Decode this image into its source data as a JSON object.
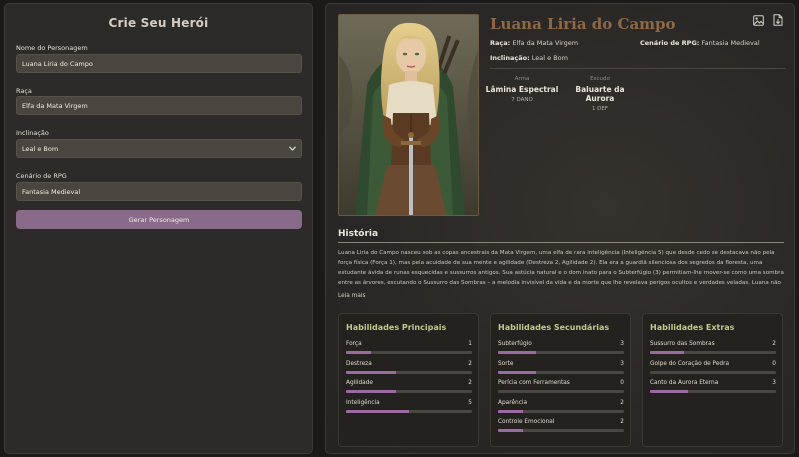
{
  "form": {
    "title": "Crie Seu Herói",
    "name_label": "Nome do Personagem",
    "name_value": "Luana Liria do Campo",
    "race_label": "Raça",
    "race_value": "Elfa da Mata Virgem",
    "alignment_label": "Inclinação",
    "alignment_value": "Leal e Bom",
    "setting_label": "Cenário de RPG",
    "setting_value": "Fantasia Medieval",
    "generate_label": "Gerar Personagem"
  },
  "character": {
    "name": "Luana Liria do Campo",
    "race_key": "Raça:",
    "race_value": "Elfa da Mata Virgem",
    "setting_key": "Cenário de RPG:",
    "setting_value": "Fantasia Medieval",
    "alignment_key": "Inclinação:",
    "alignment_value": "Leal e Bom",
    "weapon_caption": "Arma",
    "weapon_name": "Lâmina Espectral",
    "weapon_stat": "7 DANO",
    "shield_caption": "Escudo",
    "shield_name": "Baluarte da Aurora",
    "shield_stat": "1 DEF"
  },
  "story": {
    "title": "História",
    "text": "Luana Liria do Campo nasceu sob as copas ancestrais da Mata Virgem, uma elfa de rara inteligência (Inteligência 5) que desde cedo se destacava não pela força física (Força 1), mas pela acuidade de sua mente e agilidade (Destreza 2, Agilidade 2). Ela era a guardiã silenciosa dos segredos da floresta, uma estudante ávida de runas esquecidas e sussurros antigos. Sua astúcia natural e o dom inato para o Subterfúgio (3) permitiam-lhe mover-se como uma sombra entre as árvores, escutando o Sussurro das Sombras – a melodia invisível da vida e da morte que lhe revelava perigos ocultos e verdades veladas. Luana não usava essa ...",
    "read_more": "Leia mais"
  },
  "skills": {
    "main": {
      "title": "Habilidades Principais",
      "items": [
        {
          "label": "Força",
          "value": "1",
          "level": 0.2
        },
        {
          "label": "Destreza",
          "value": "2",
          "level": 0.4
        },
        {
          "label": "Agilidade",
          "value": "2",
          "level": 0.4
        },
        {
          "label": "Inteligência",
          "value": "5",
          "level": 0.5
        }
      ]
    },
    "secondary": {
      "title": "Habilidades Secundárias",
      "items": [
        {
          "label": "Subterfúgio",
          "value": "3",
          "level": 0.3
        },
        {
          "label": "Sorte",
          "value": "3",
          "level": 0.3
        },
        {
          "label": "Perícia com Ferramentas",
          "value": "0",
          "level": 0
        },
        {
          "label": "Aparência",
          "value": "2",
          "level": 0.2
        },
        {
          "label": "Controle Emocional",
          "value": "2",
          "level": 0.2
        }
      ]
    },
    "extra": {
      "title": "Habilidades Extras",
      "items": [
        {
          "label": "Sussurro das Sombras",
          "value": "2",
          "level": 0.27
        },
        {
          "label": "Golpe do Coração de Pedra",
          "value": "0",
          "level": 0
        },
        {
          "label": "Canto da Aurora Eterna",
          "value": "3",
          "level": 0.3
        }
      ]
    }
  },
  "icons": {
    "image": "image-icon",
    "export": "file-export-icon"
  },
  "colors": {
    "accent": "#8a6a8a",
    "name": "#8f6846",
    "skill_title": "#c3c98d",
    "skill_fill": "#9a6aa0"
  }
}
